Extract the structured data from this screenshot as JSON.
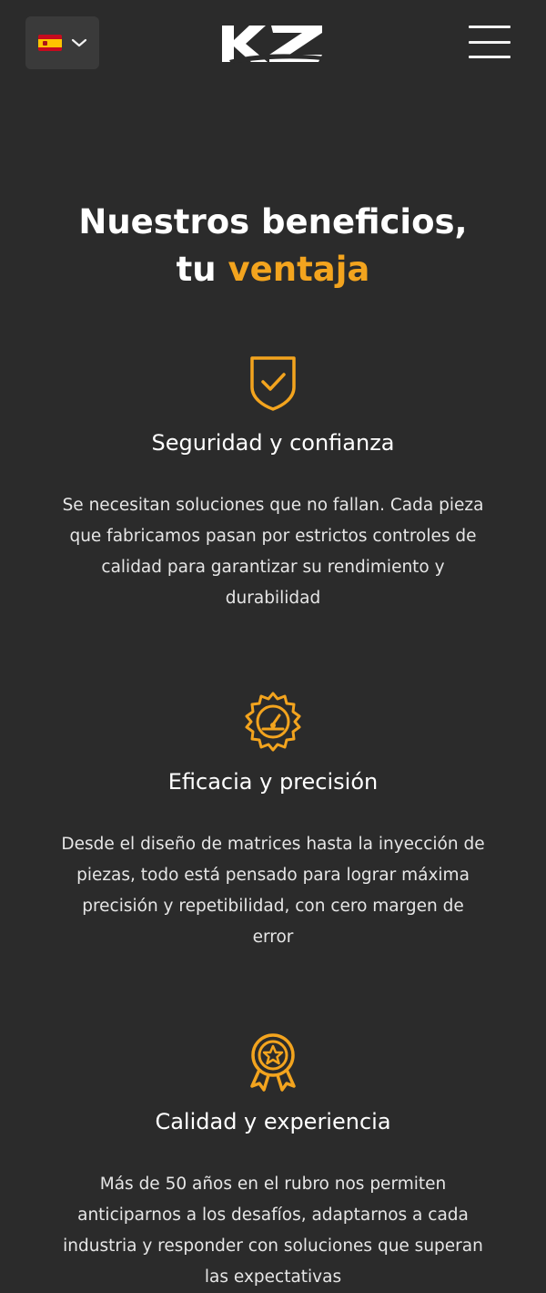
{
  "header": {
    "language": "Español",
    "logo_text": "KZ"
  },
  "hero": {
    "title_line1": "Nuestros beneficios,",
    "title_line2_prefix": "tu",
    "title_line2_accent": "ventaja"
  },
  "benefits": [
    {
      "icon": "shield-check-icon",
      "title": "Seguridad y confianza",
      "description": "Se necesitan soluciones que no fallan. Cada pieza que fabricamos pasan por estrictos controles de calidad para garantizar su rendimiento y durabilidad"
    },
    {
      "icon": "gear-gauge-icon",
      "title": "Eficacia y precisión",
      "description": "Desde el diseño de matrices hasta la inyección de piezas, todo está pensado para lograr máxima precisión y repetibilidad, con cero margen de error"
    },
    {
      "icon": "award-badge-icon",
      "title": "Calidad y experiencia",
      "description": "Más de 50 años en el rubro nos permiten anticiparnos a los desafíos, adaptarnos a cada industria y responder con soluciones que superan las expectativas"
    }
  ],
  "colors": {
    "background": "#2b2b2b",
    "accent": "#f3a41e",
    "text": "#ffffff"
  }
}
